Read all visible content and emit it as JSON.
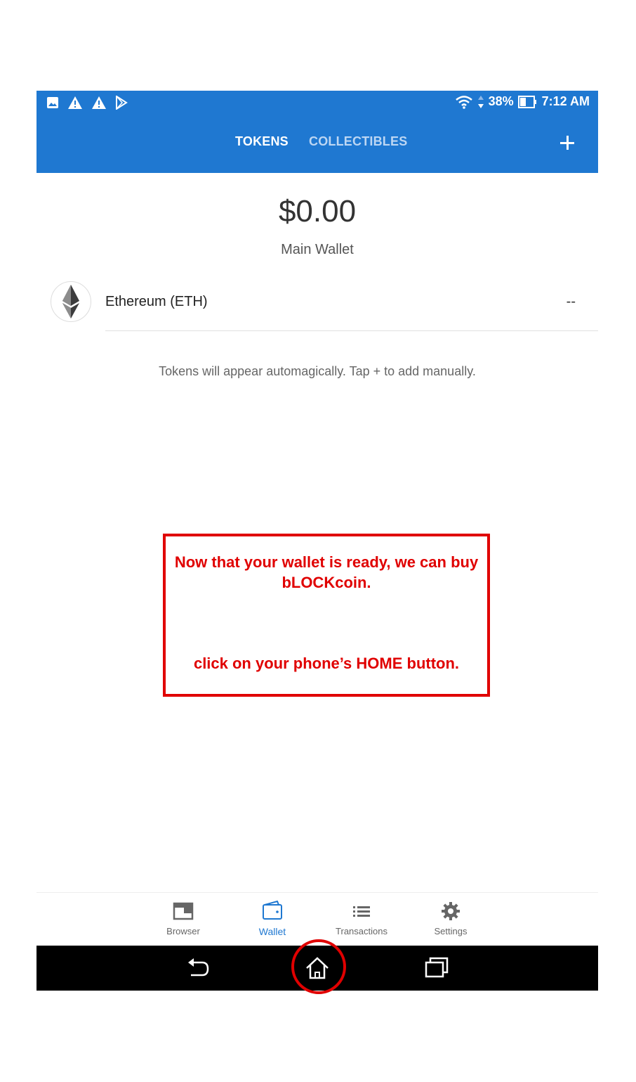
{
  "status_bar": {
    "battery": "38%",
    "time": "7:12 AM",
    "left_icons": [
      "image-icon",
      "warning-icon",
      "warning-icon",
      "play-store-icon"
    ],
    "right_icons": [
      "wifi-icon",
      "data-arrows-icon",
      "battery-icon"
    ]
  },
  "tabs": [
    {
      "label": "TOKENS",
      "active": true
    },
    {
      "label": "COLLECTIBLES",
      "active": false
    }
  ],
  "balance": "$0.00",
  "wallet_name": "Main Wallet",
  "tokens": [
    {
      "name": "Ethereum (ETH)",
      "value": "--",
      "icon": "ethereum-icon"
    }
  ],
  "hint": "Tokens will appear automagically. Tap + to add manually.",
  "callout": {
    "line1": "Now that your wallet is ready, we can buy bLOCKcoin.",
    "line2": "click on your phone’s HOME button.",
    "color": "#e00000"
  },
  "bottom_nav": [
    {
      "label": "Browser",
      "icon": "browser-icon",
      "active": false
    },
    {
      "label": "Wallet",
      "icon": "wallet-icon",
      "active": true
    },
    {
      "label": "Transactions",
      "icon": "list-icon",
      "active": false
    },
    {
      "label": "Settings",
      "icon": "gear-icon",
      "active": false
    }
  ],
  "system_nav": [
    "back-icon",
    "home-icon",
    "recents-icon"
  ],
  "colors": {
    "primary": "#1f78d1",
    "accent_red": "#e00000"
  }
}
